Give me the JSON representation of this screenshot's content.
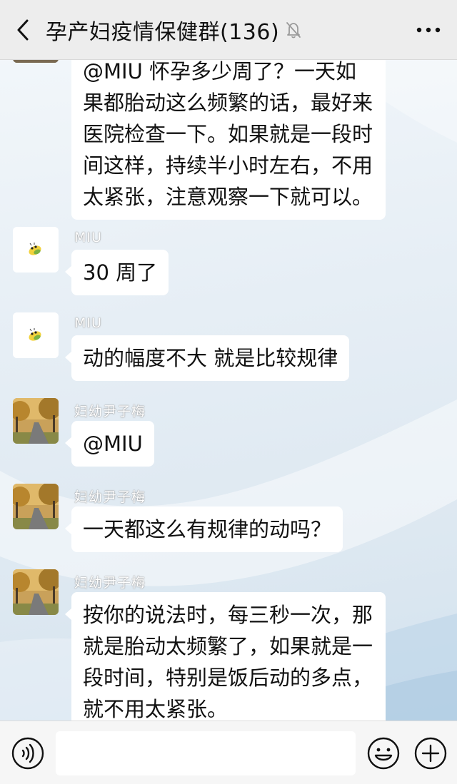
{
  "header": {
    "title": "孕产妇疫情保健群(136)",
    "back_icon": "chevron-left-icon",
    "mute_icon": "bell-off-icon",
    "more_icon": "more-dots-icon"
  },
  "messages": [
    {
      "sender": "",
      "avatar": "landscape",
      "lines": [
        "@MIU 怀孕多少周了？一天如",
        "果都胎动这么频繁的话，最好来",
        "医院检查一下。如果就是一段时",
        "间这样，持续半小时左右，不用",
        "太紧张，注意观察一下就可以。"
      ]
    },
    {
      "sender": "MIU",
      "avatar": "cartoon",
      "lines": [
        "30 周了"
      ]
    },
    {
      "sender": "MIU",
      "avatar": "cartoon",
      "lines": [
        "动的幅度不大 就是比较规律"
      ]
    },
    {
      "sender": "妇幼尹子梅",
      "avatar": "landscape",
      "lines": [
        "@MIU"
      ]
    },
    {
      "sender": "妇幼尹子梅",
      "avatar": "landscape",
      "lines": [
        "一天都这么有规律的动吗？"
      ]
    },
    {
      "sender": "妇幼尹子梅",
      "avatar": "landscape",
      "lines": [
        "按你的说法时，每三秒一次，那",
        "就是胎动太频繁了，如果就是一",
        "段时间，特别是饭后动的多点，",
        "就不用太紧张。"
      ]
    }
  ],
  "inputbar": {
    "voice_icon": "voice-icon",
    "emoji_icon": "emoji-icon",
    "plus_icon": "plus-icon",
    "input_value": ""
  },
  "colors": {
    "header_bg": "#ededed",
    "bubble_bg": "#ffffff",
    "wallpaper": "#e6eef5"
  }
}
